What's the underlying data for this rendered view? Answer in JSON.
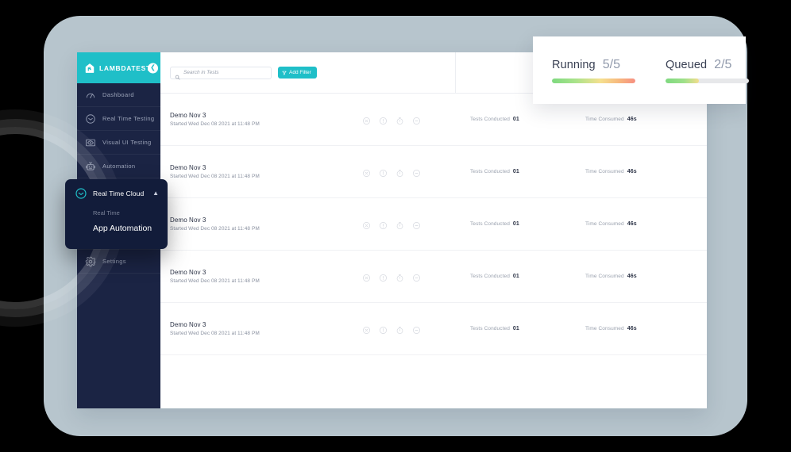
{
  "brand": {
    "name": "LAMBDATEST",
    "logo_icon": "lambdatest-logo-icon",
    "collapse_icon": "chevron-left-icon"
  },
  "sidebar": {
    "items": [
      {
        "label": "Dashboard",
        "icon": "speedometer-icon"
      },
      {
        "label": "Real Time Testing",
        "icon": "clock-icon"
      },
      {
        "label": "Visual UI Testing",
        "icon": "eye-icon"
      },
      {
        "label": "Automation",
        "icon": "robot-icon"
      },
      {
        "label": "Settings",
        "icon": "gear-icon"
      }
    ]
  },
  "popup": {
    "icon": "realtime-cloud-clock-icon",
    "title": "Real Time Cloud",
    "chevron_icon": "chevron-up-icon",
    "items": [
      {
        "label": "Real Time"
      },
      {
        "label": "App Automation"
      }
    ]
  },
  "toolbar": {
    "search_placeholder": "Search in Tests",
    "search_value": "",
    "search_icon": "search-icon",
    "add_filter_label": "Add Filter",
    "filter_icon": "funnel-icon"
  },
  "tests": {
    "tests_conducted_label": "Tests Conducted",
    "time_consumed_label": "Time Consumed",
    "status_icons": [
      "close-circle-icon",
      "warning-circle-icon",
      "timer-icon",
      "minus-circle-icon"
    ],
    "rows": [
      {
        "title": "Demo Nov 3",
        "subtitle": "Started Wed Dec 08 2021 at 11:48 PM",
        "tests_conducted": "01",
        "time_consumed": "46s"
      },
      {
        "title": "Demo Nov 3",
        "subtitle": "Started Wed Dec 08 2021 at 11:48 PM",
        "tests_conducted": "01",
        "time_consumed": "46s"
      },
      {
        "title": "Demo Nov 3",
        "subtitle": "Started Wed Dec 08 2021 at 11:48 PM",
        "tests_conducted": "01",
        "time_consumed": "46s"
      },
      {
        "title": "Demo Nov 3",
        "subtitle": "Started Wed Dec 08 2021 at 11:48 PM",
        "tests_conducted": "01",
        "time_consumed": "46s"
      },
      {
        "title": "Demo Nov 3",
        "subtitle": "Started Wed Dec 08 2021 at 11:48 PM",
        "tests_conducted": "01",
        "time_consumed": "46s"
      }
    ]
  },
  "stats_panel": {
    "blocks": [
      {
        "name": "Running",
        "value": "5/5",
        "percent": 100
      },
      {
        "name": "Queued",
        "value": "2/5",
        "percent": 40
      }
    ]
  },
  "colors": {
    "brand_teal": "#1fbfc8",
    "sidebar_navy": "#1b2444",
    "popup_navy": "#121c3a",
    "frame_gray": "#b7c5cd"
  }
}
